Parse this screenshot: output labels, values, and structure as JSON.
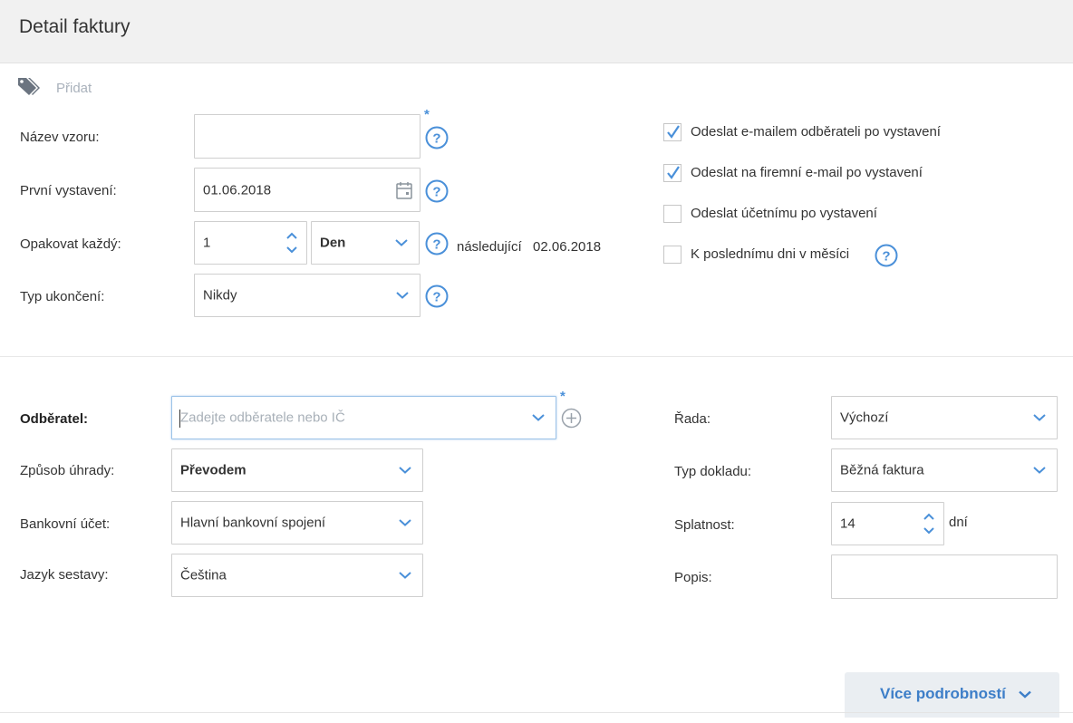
{
  "header": {
    "title": "Detail faktury"
  },
  "tags": {
    "add_label": "Přidat",
    "icon": "tags-icon"
  },
  "template": {
    "name": {
      "label": "Název vzoru:",
      "value": "",
      "required_mark": "*"
    },
    "first_issue": {
      "label": "První vystavení:",
      "value": "01.06.2018"
    },
    "repeat": {
      "label": "Opakovat každý:",
      "count": "1",
      "unit": "Den",
      "next_label": "následující",
      "next_date": "02.06.2018"
    },
    "end_type": {
      "label": "Typ ukončení:",
      "value": "Nikdy"
    }
  },
  "options": [
    {
      "label": "Odeslat e-mailem odběrateli po vystavení",
      "checked": true
    },
    {
      "label": "Odeslat na firemní e-mail po vystavení",
      "checked": true
    },
    {
      "label": "Odeslat účetnímu po vystavení",
      "checked": false
    },
    {
      "label": "K poslednímu dni v měsíci",
      "checked": false
    }
  ],
  "invoice": {
    "customer": {
      "label": "Odběratel:",
      "placeholder": "Zadejte odběratele nebo IČ",
      "required_mark": "*"
    },
    "payment": {
      "label": "Způsob úhrady:",
      "value": "Převodem"
    },
    "bank": {
      "label": "Bankovní účet:",
      "value": "Hlavní bankovní spojení"
    },
    "language": {
      "label": "Jazyk sestavy:",
      "value": "Čeština"
    },
    "series": {
      "label": "Řada:",
      "value": "Výchozí"
    },
    "doc_type": {
      "label": "Typ dokladu:",
      "value": "Běžná faktura"
    },
    "due": {
      "label": "Splatnost:",
      "value": "14",
      "unit": "dní"
    },
    "description": {
      "label": "Popis:",
      "value": ""
    }
  },
  "footer": {
    "more_label": "Více podrobností"
  },
  "colors": {
    "accent": "#4a90d9",
    "header_bg": "#f1f1f1"
  }
}
